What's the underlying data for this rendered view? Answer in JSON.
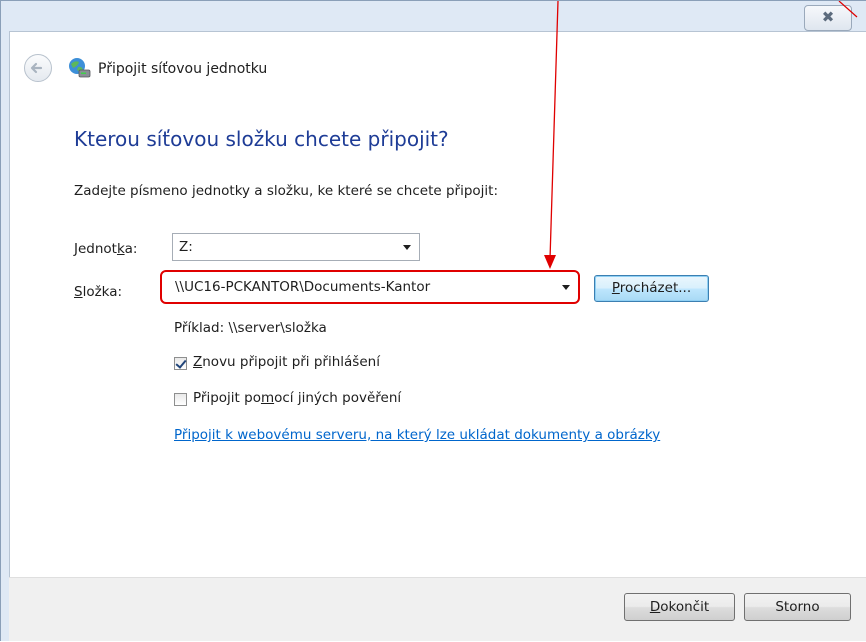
{
  "window": {
    "close_glyph": "✖",
    "title": "Připojit síťovou jednotku"
  },
  "header": {
    "back_icon": "back-arrow-icon",
    "wizard_icon": "network-drive-icon"
  },
  "main": {
    "heading": "Kterou síťovou složku chcete připojit?",
    "instruction": "Zadejte písmeno jednotky a složku, ke které se chcete připojit:",
    "drive": {
      "label_pre": "Jednot",
      "label_key": "k",
      "label_post": "a:",
      "value": "Z:"
    },
    "folder": {
      "label_key": "S",
      "label_post": "ložka:",
      "value": "\\\\UC16-PCKANTOR\\Documents-Kantor"
    },
    "browse": {
      "label_key": "P",
      "label_post": "rocházet..."
    },
    "example": "Příklad: \\\\server\\složka",
    "reconnect": {
      "checked": true,
      "label_key": "Z",
      "label_post": "novu připojit při přihlášení"
    },
    "other_credentials": {
      "checked": false,
      "label_pre": "Připojit po",
      "label_key": "m",
      "label_post": "ocí jiných pověření"
    },
    "web_link": "Připojit k webovému serveru, na který lze ukládat dokumenty a obrázky"
  },
  "footer": {
    "finish": {
      "label_key": "D",
      "label_post": "okončit"
    },
    "cancel": "Storno"
  },
  "annotation": {
    "color": "#e00000"
  }
}
